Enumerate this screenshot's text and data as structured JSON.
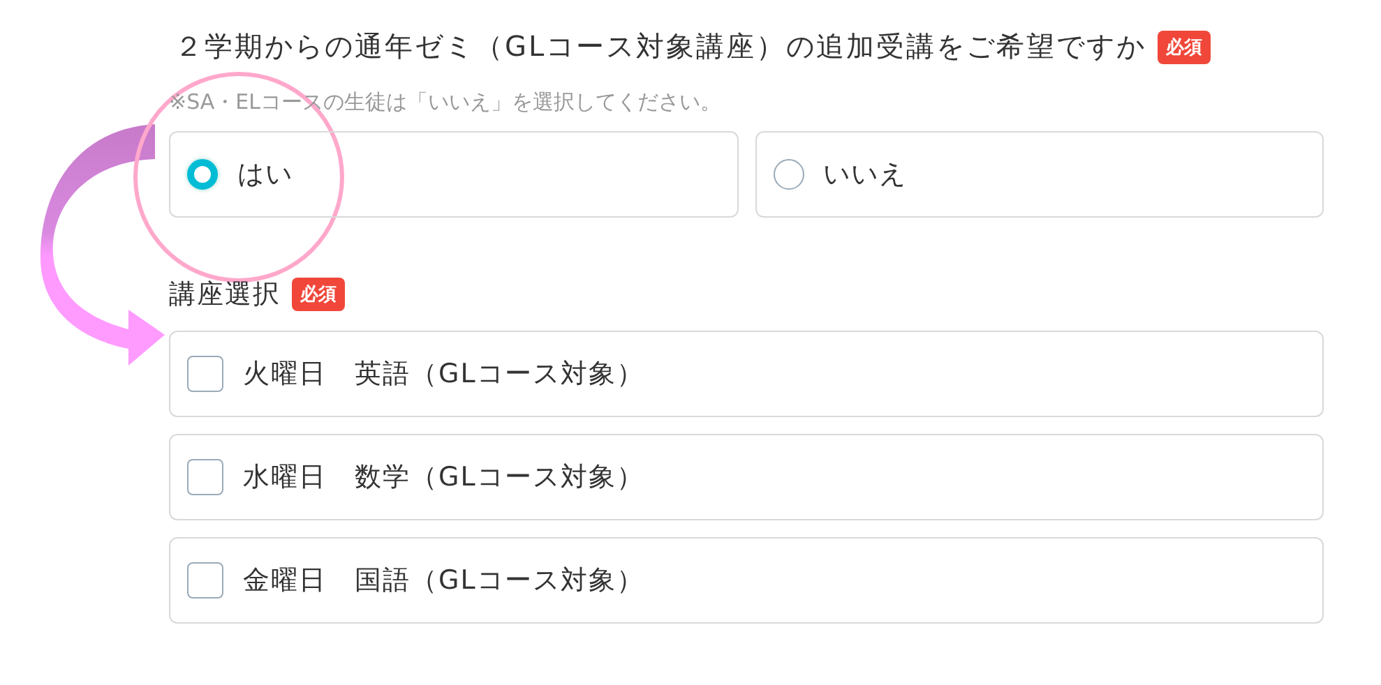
{
  "question": {
    "label": "２学期からの通年ゼミ（GLコース対象講座）の追加受講をご希望ですか",
    "required_badge": "必須",
    "note": "※SA・ELコースの生徒は「いいえ」を選択してください。",
    "options": [
      {
        "label": "はい",
        "selected": true
      },
      {
        "label": "いいえ",
        "selected": false
      }
    ]
  },
  "course_select": {
    "label": "講座選択",
    "required_badge": "必須",
    "options": [
      {
        "label": "火曜日　英語（GLコース対象）",
        "checked": false
      },
      {
        "label": "水曜日　数学（GLコース対象）",
        "checked": false
      },
      {
        "label": "金曜日　国語（GLコース対象）",
        "checked": false
      }
    ]
  }
}
